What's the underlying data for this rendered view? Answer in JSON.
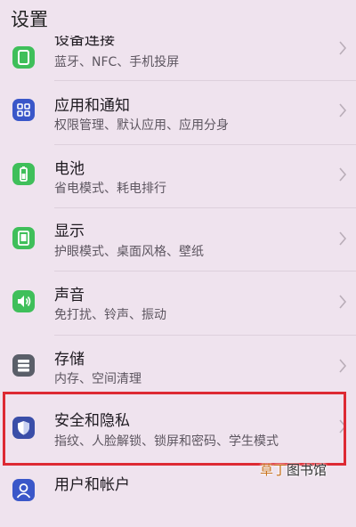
{
  "header": {
    "title": "设置"
  },
  "settings": {
    "items": [
      {
        "title": "设备连接",
        "subtitle": "蓝牙、NFC、手机投屏",
        "icon": "device-connection-icon",
        "color": "#3fbf5a"
      },
      {
        "title": "应用和通知",
        "subtitle": "权限管理、默认应用、应用分身",
        "icon": "apps-grid-icon",
        "color": "#3a57c9"
      },
      {
        "title": "电池",
        "subtitle": "省电模式、耗电排行",
        "icon": "battery-icon",
        "color": "#3fbf5a"
      },
      {
        "title": "显示",
        "subtitle": "护眼模式、桌面风格、壁纸",
        "icon": "display-icon",
        "color": "#3fbf5a"
      },
      {
        "title": "声音",
        "subtitle": "免打扰、铃声、振动",
        "icon": "speaker-icon",
        "color": "#3fbf5a"
      },
      {
        "title": "存储",
        "subtitle": "内存、空间清理",
        "icon": "storage-icon",
        "color": "#5a5f69"
      },
      {
        "title": "安全和隐私",
        "subtitle": "指纹、人脸解锁、锁屏和密码、学生模式",
        "icon": "shield-icon",
        "color": "#3a4ea8"
      },
      {
        "title": "用户和帐户",
        "subtitle": "",
        "icon": "user-account-icon",
        "color": "#3a57c9"
      }
    ]
  },
  "annotation": {
    "highlight_color": "#dd2a33"
  },
  "watermark": {
    "part1": "草丁",
    "part2": "图书馆"
  }
}
